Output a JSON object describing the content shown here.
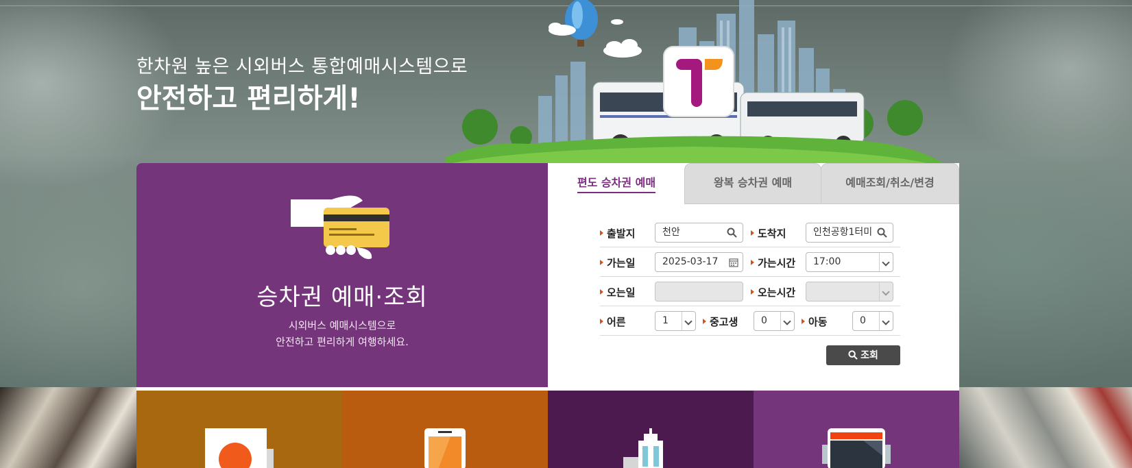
{
  "hero": {
    "subheadline": "한차원 높은 시외버스 통합예매시스템으로",
    "headline": "안전하고 편리하게!"
  },
  "promo": {
    "title": "승차권 예매·조회",
    "desc_line1": "시외버스 예매시스템으로",
    "desc_line2": "안전하고 편리하게 여행하세요."
  },
  "tabs": [
    {
      "label": "편도 승차권 예매",
      "active": true
    },
    {
      "label": "왕복 승차권 예매",
      "active": false
    },
    {
      "label": "예매조회/취소/변경",
      "active": false
    }
  ],
  "form": {
    "departure_label": "출발지",
    "departure_value": "천안",
    "arrival_label": "도착지",
    "arrival_value": "인천공항1터미",
    "go_date_label": "가는일",
    "go_date_value": "2025-03-17",
    "go_time_label": "가는시간",
    "go_time_value": "17:00",
    "return_date_label": "오는일",
    "return_date_value": "",
    "return_time_label": "오는시간",
    "return_time_value": "",
    "adult_label": "어른",
    "adult_value": "1",
    "teen_label": "중고생",
    "teen_value": "0",
    "child_label": "아동",
    "child_value": "0",
    "search_label": "조회"
  },
  "colors": {
    "purple": "#75357a",
    "dark_purple": "#4c1a4f",
    "mustard": "#a8680f",
    "orange": "#b95c10",
    "accent_arrow": "#d3541a",
    "button": "#4a4a4a"
  },
  "icons": [
    "card-payment-icon",
    "search-icon",
    "calendar-icon",
    "receipt-won-icon",
    "mobile-phone-icon",
    "city-building-icon",
    "bus-front-icon",
    "logo-t-icon"
  ]
}
